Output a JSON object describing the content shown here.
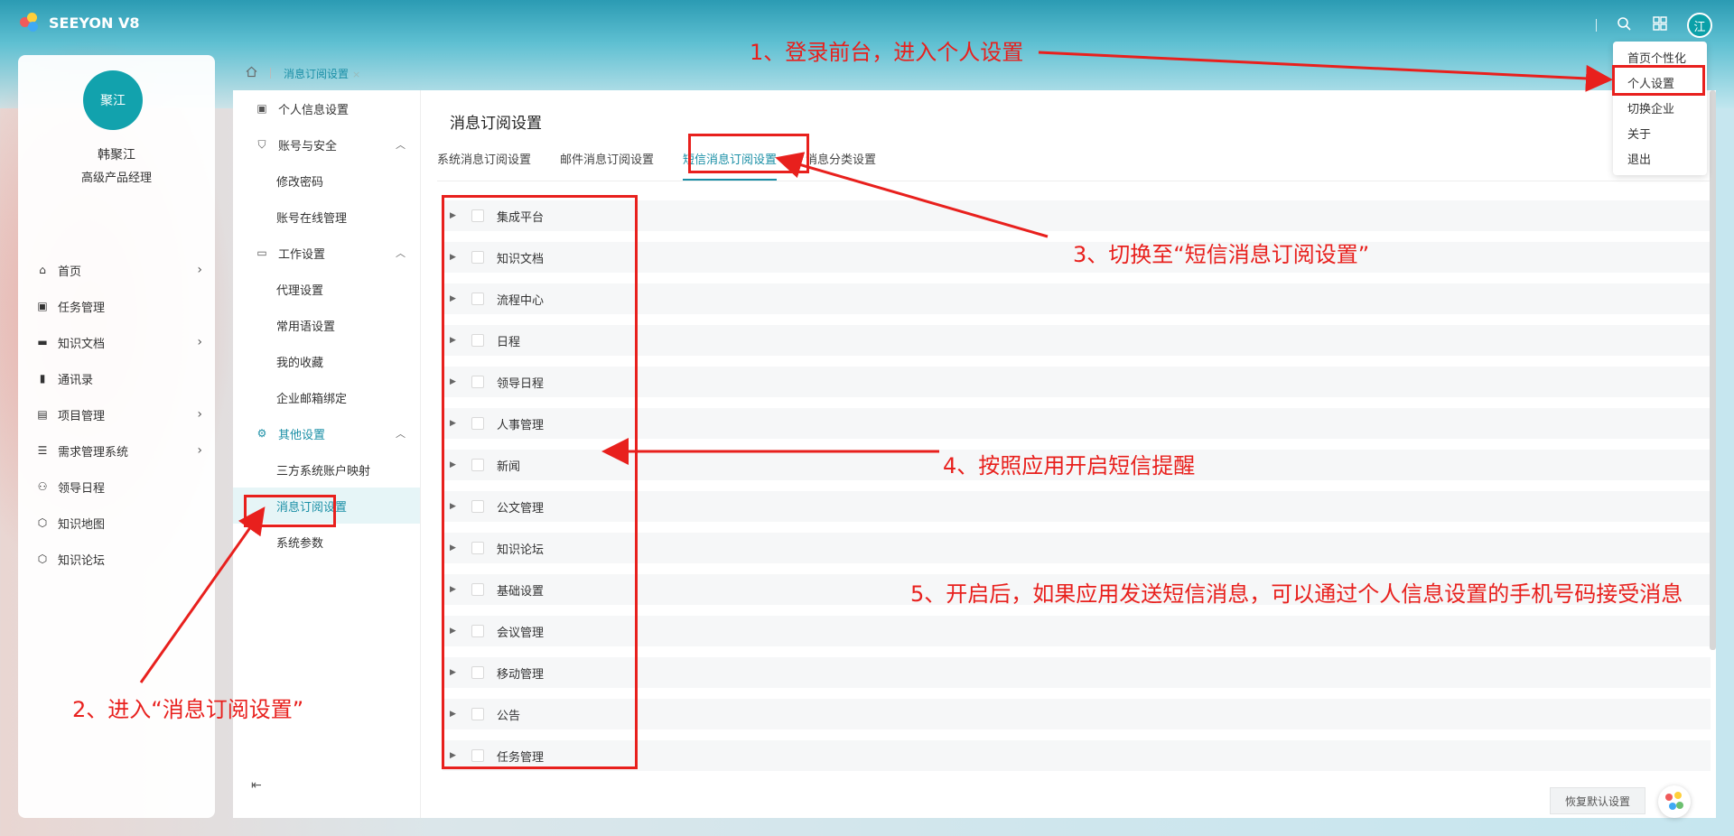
{
  "app": {
    "logo_text": "SEEYON V8",
    "user_initial": "江"
  },
  "user": {
    "avatar_text": "聚江",
    "name": "韩聚江",
    "title": "高级产品经理"
  },
  "nav": {
    "items": [
      {
        "label": "首页",
        "icon": "home-icon",
        "glyph": "⌂",
        "chevron": true
      },
      {
        "label": "任务管理",
        "icon": "task-icon",
        "glyph": "▣",
        "chevron": false
      },
      {
        "label": "知识文档",
        "icon": "folder-icon",
        "glyph": "▬",
        "chevron": true
      },
      {
        "label": "通讯录",
        "icon": "contacts-icon",
        "glyph": "▮",
        "chevron": false
      },
      {
        "label": "项目管理",
        "icon": "clipboard-icon",
        "glyph": "▤",
        "chevron": true
      },
      {
        "label": "需求管理系统",
        "icon": "list-icon",
        "glyph": "☰",
        "chevron": true
      },
      {
        "label": "领导日程",
        "icon": "people-icon",
        "glyph": "⚇",
        "chevron": false
      },
      {
        "label": "知识地图",
        "icon": "cube-icon",
        "glyph": "⬡",
        "chevron": false
      },
      {
        "label": "知识论坛",
        "icon": "cube-icon",
        "glyph": "⬡",
        "chevron": false
      }
    ]
  },
  "breadcrumb": {
    "tab_label": "消息订阅设置",
    "close": "×"
  },
  "settings_nav": {
    "personal_info": "个人信息设置",
    "account_security": "账号与安全",
    "change_password": "修改密码",
    "account_online": "账号在线管理",
    "work_settings": "工作设置",
    "proxy": "代理设置",
    "common_phrases": "常用语设置",
    "favorites": "我的收藏",
    "mailbox_binding": "企业邮箱绑定",
    "other_settings": "其他设置",
    "third_party": "三方系统账户映射",
    "message_subscription": "消息订阅设置",
    "system_params": "系统参数"
  },
  "content": {
    "title": "消息订阅设置",
    "tabs": [
      "系统消息订阅设置",
      "邮件消息订阅设置",
      "短信消息订阅设置",
      "消息分类设置"
    ],
    "active_tab": 2,
    "apps": [
      "集成平台",
      "知识文档",
      "流程中心",
      "日程",
      "领导日程",
      "人事管理",
      "新闻",
      "公文管理",
      "知识论坛",
      "基础设置",
      "会议管理",
      "移动管理",
      "公告",
      "任务管理"
    ],
    "restore_button": "恢复默认设置"
  },
  "dropdown": {
    "items": [
      "首页个性化",
      "个人设置",
      "切换企业",
      "关于",
      "退出"
    ]
  },
  "annotations": {
    "step1": "1、登录前台，进入个人设置",
    "step2": "2、进入“消息订阅设置”",
    "step3": "3、切换至“短信消息订阅设置”",
    "step4": "4、按照应用开启短信提醒",
    "step5": "5、开启后，如果应用发送短信消息，可以通过个人信息设置的手机号码接受消息"
  },
  "colors": {
    "accent": "#1a8fa6",
    "annotation_red": "#e8201d",
    "avatar_teal": "#12a2ad"
  }
}
